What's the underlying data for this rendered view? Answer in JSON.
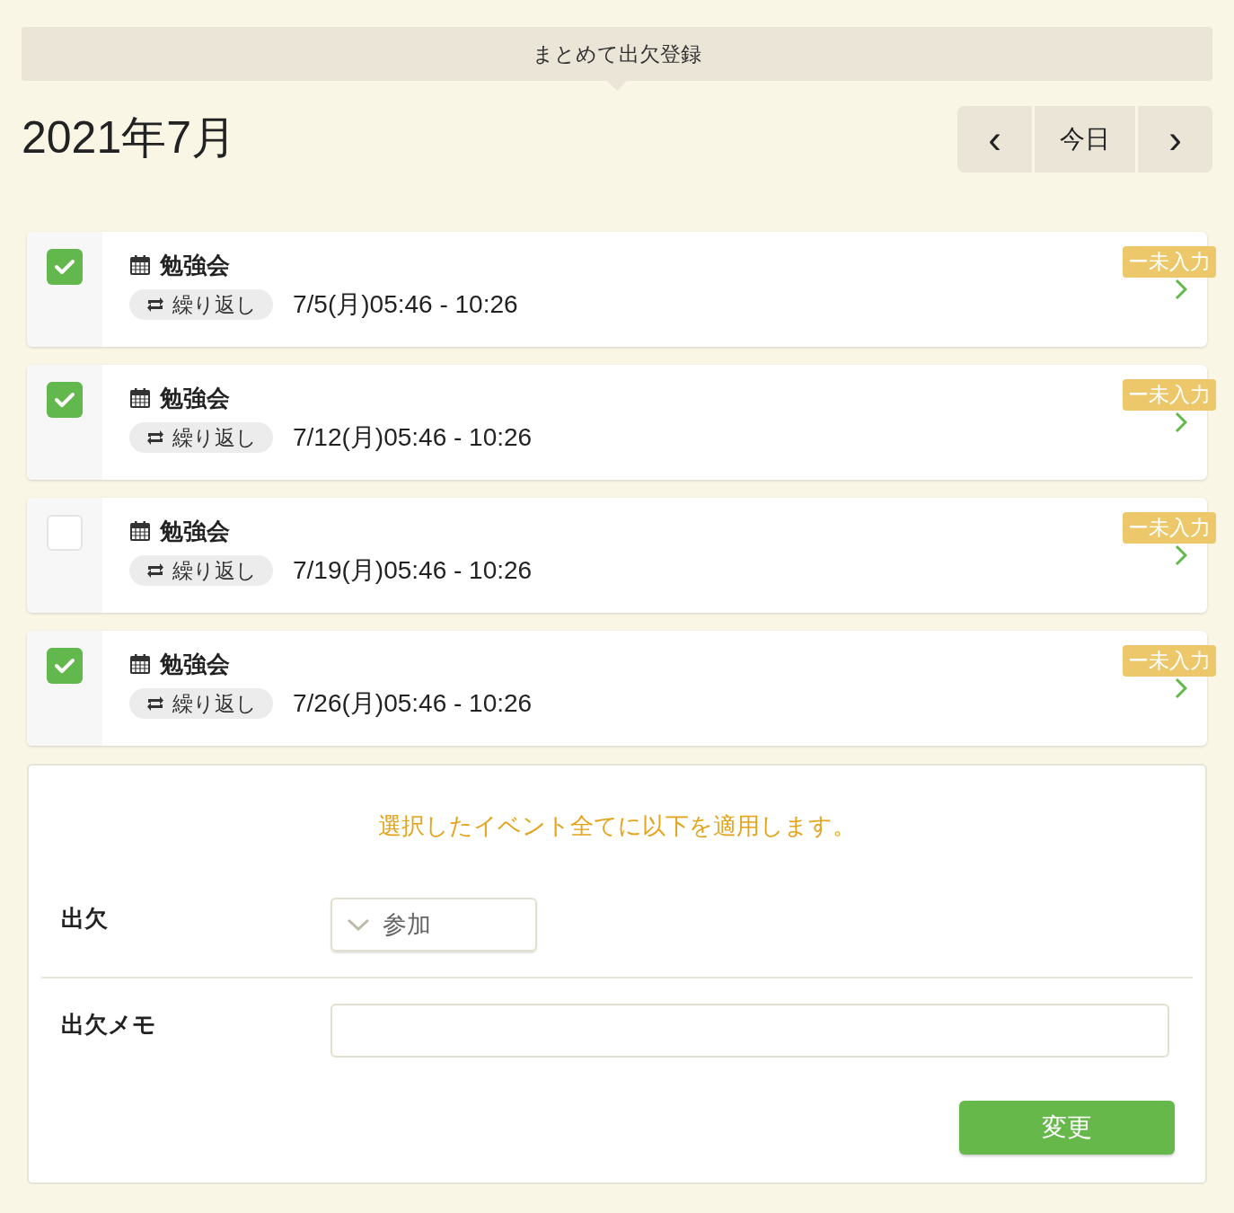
{
  "header": {
    "title": "まとめて出欠登録"
  },
  "month": "2021年7月",
  "nav": {
    "prev": "‹",
    "today": "今日",
    "next": "›"
  },
  "events": [
    {
      "checked": true,
      "title": "勉強会",
      "repeat": "繰り返し",
      "time": "7/5(月)05:46 - 10:26",
      "status": "ー未入力"
    },
    {
      "checked": true,
      "title": "勉強会",
      "repeat": "繰り返し",
      "time": "7/12(月)05:46 - 10:26",
      "status": "ー未入力"
    },
    {
      "checked": false,
      "title": "勉強会",
      "repeat": "繰り返し",
      "time": "7/19(月)05:46 - 10:26",
      "status": "ー未入力"
    },
    {
      "checked": true,
      "title": "勉強会",
      "repeat": "繰り返し",
      "time": "7/26(月)05:46 - 10:26",
      "status": "ー未入力"
    }
  ],
  "form": {
    "notice": "選択したイベント全てに以下を適用します。",
    "attendance_label": "出欠",
    "attendance_value": "参加",
    "memo_label": "出欠メモ",
    "submit": "変更"
  }
}
